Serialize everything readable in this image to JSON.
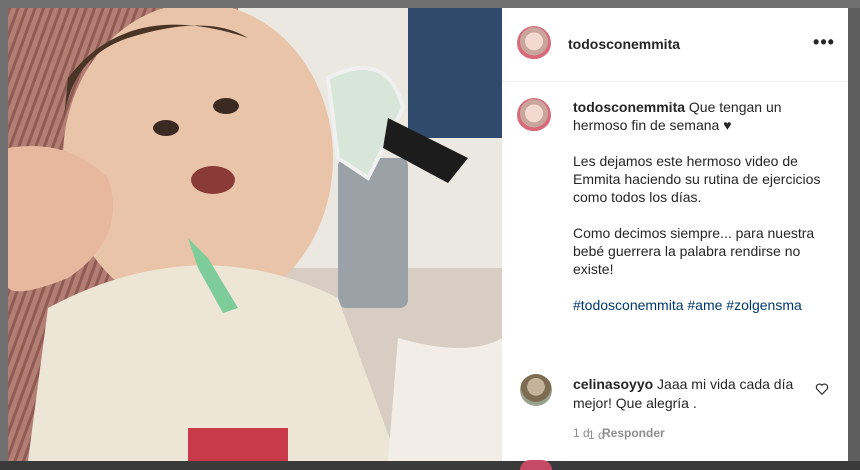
{
  "post": {
    "username": "todosconemmita",
    "caption_username": "todosconemmita",
    "caption_line1": "Que tengan un hermoso fin de semana ♥",
    "caption_line2": "Les dejamos este hermoso video de Emmita haciendo su rutina de ejercicios como todos los días.",
    "caption_line3": "Como decimos siempre... para nuestra bebé guerrera la palabra rendirse no existe!",
    "hashtags": "#todosconemmita #ame #zolgensma",
    "time": "1 d"
  },
  "comment": {
    "username": "celinasoyyo",
    "text": "Jaaa mi vida cada día mejor! Que alegría .",
    "time": "1 d",
    "reply_label": "Responder"
  },
  "icons": {
    "more": "more-horizontal-icon",
    "heart": "heart-icon"
  },
  "colors": {
    "link": "#00376b",
    "text": "#262626",
    "muted": "#8e8e8e"
  }
}
